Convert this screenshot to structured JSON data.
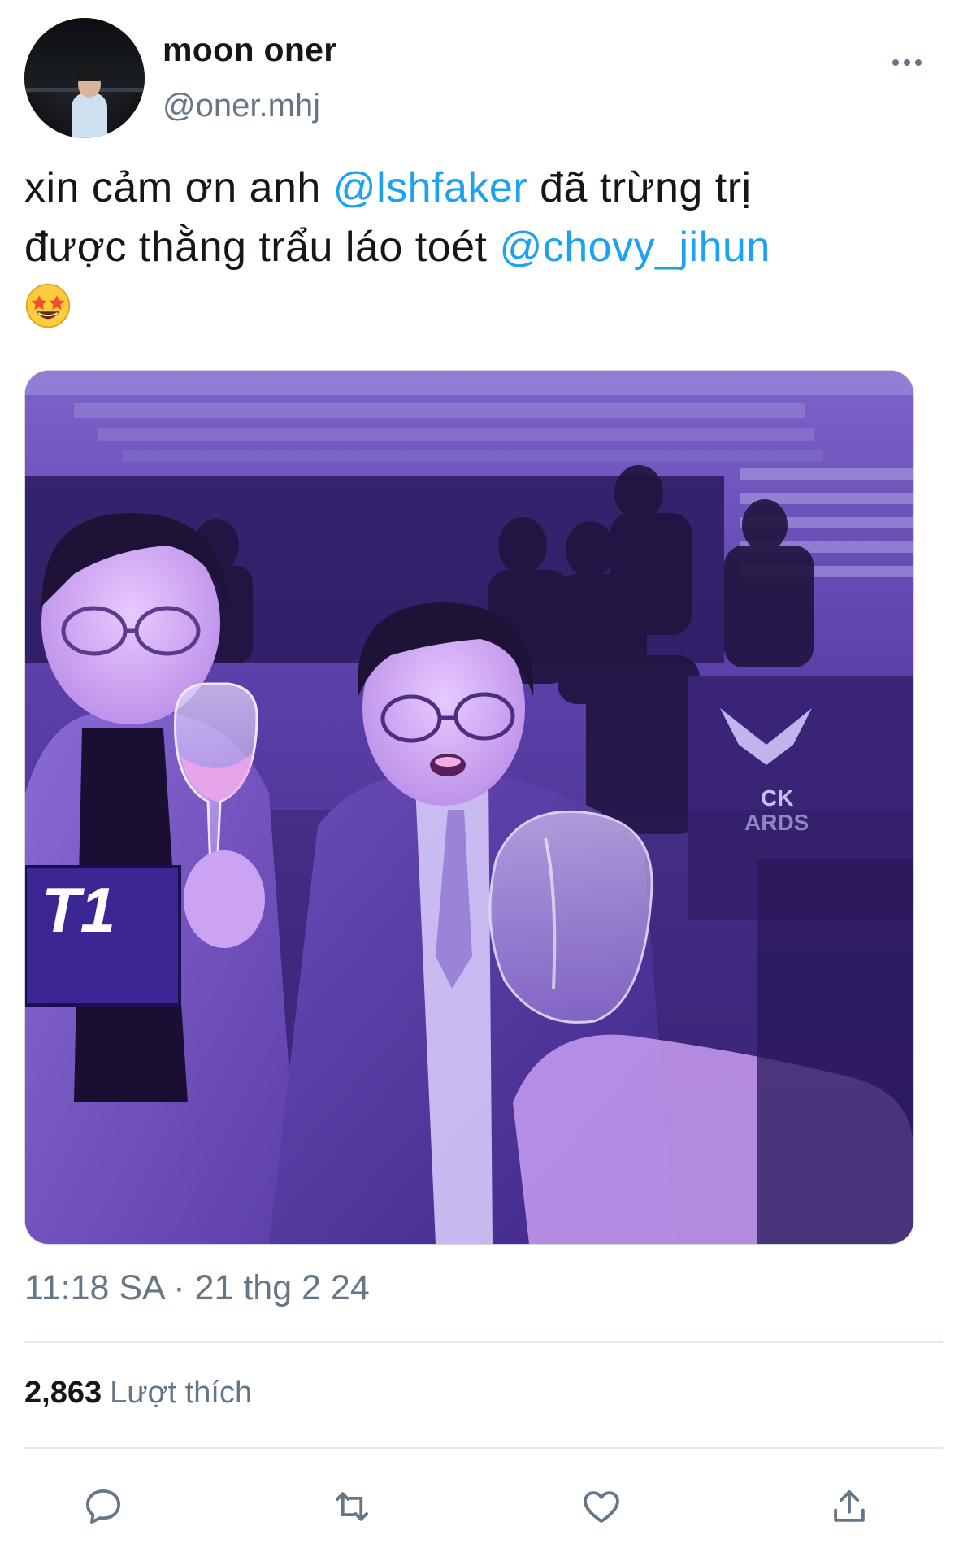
{
  "user": {
    "display_name": "moon oner",
    "handle": "@oner.mhj"
  },
  "tweet": {
    "text_parts": {
      "p1": "xin cảm ơn anh ",
      "mention1": "@lshfaker",
      "p2": " đã trừng trị",
      "p3": "được thằng trẩu láo toét ",
      "mention2": "@chovy_jihun"
    },
    "emoji": "star-struck-emoji",
    "media_icon": "photo-of-two-men-toasting-wine-glasses"
  },
  "media_text": {
    "sign_left": "T1",
    "banner_right_line1": "CK",
    "banner_right_line2": "ARDS"
  },
  "meta": {
    "timestamp": "11:18 SA · 21 thg 2 24"
  },
  "stats": {
    "likes_count": "2,863",
    "likes_label": "Lượt thích"
  },
  "actions": {
    "reply_icon": "reply-icon",
    "retweet_icon": "retweet-icon",
    "like_icon": "heart-icon",
    "share_icon": "share-icon"
  },
  "colors": {
    "mention": "#1da1f2",
    "secondary_text": "#657786",
    "primary_text": "#14171a",
    "divider": "#e1e8ed",
    "media_tint": "#7a4fd6"
  }
}
